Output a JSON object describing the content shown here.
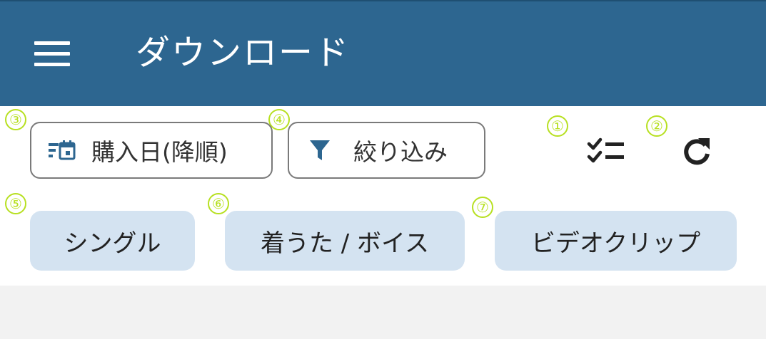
{
  "appbar": {
    "title": "ダウンロード",
    "menu_icon": "menu-icon",
    "background": "#2d6690"
  },
  "annotations": [
    "①",
    "②",
    "③",
    "④",
    "⑤",
    "⑥",
    "⑦"
  ],
  "sort_button": {
    "icon": "calendar-sort-icon",
    "label": "購入日(降順)"
  },
  "filter_button": {
    "icon": "filter-icon",
    "label": "絞り込み"
  },
  "actions": {
    "select_icon": "checklist-icon",
    "refresh_icon": "refresh-icon"
  },
  "categories": [
    {
      "label": "シングル"
    },
    {
      "label": "着うた / ボイス"
    },
    {
      "label": "ビデオクリップ"
    }
  ],
  "colors": {
    "accent": "#2d6690",
    "chip": "#d4e3f1",
    "annotation": "#b7e021"
  }
}
